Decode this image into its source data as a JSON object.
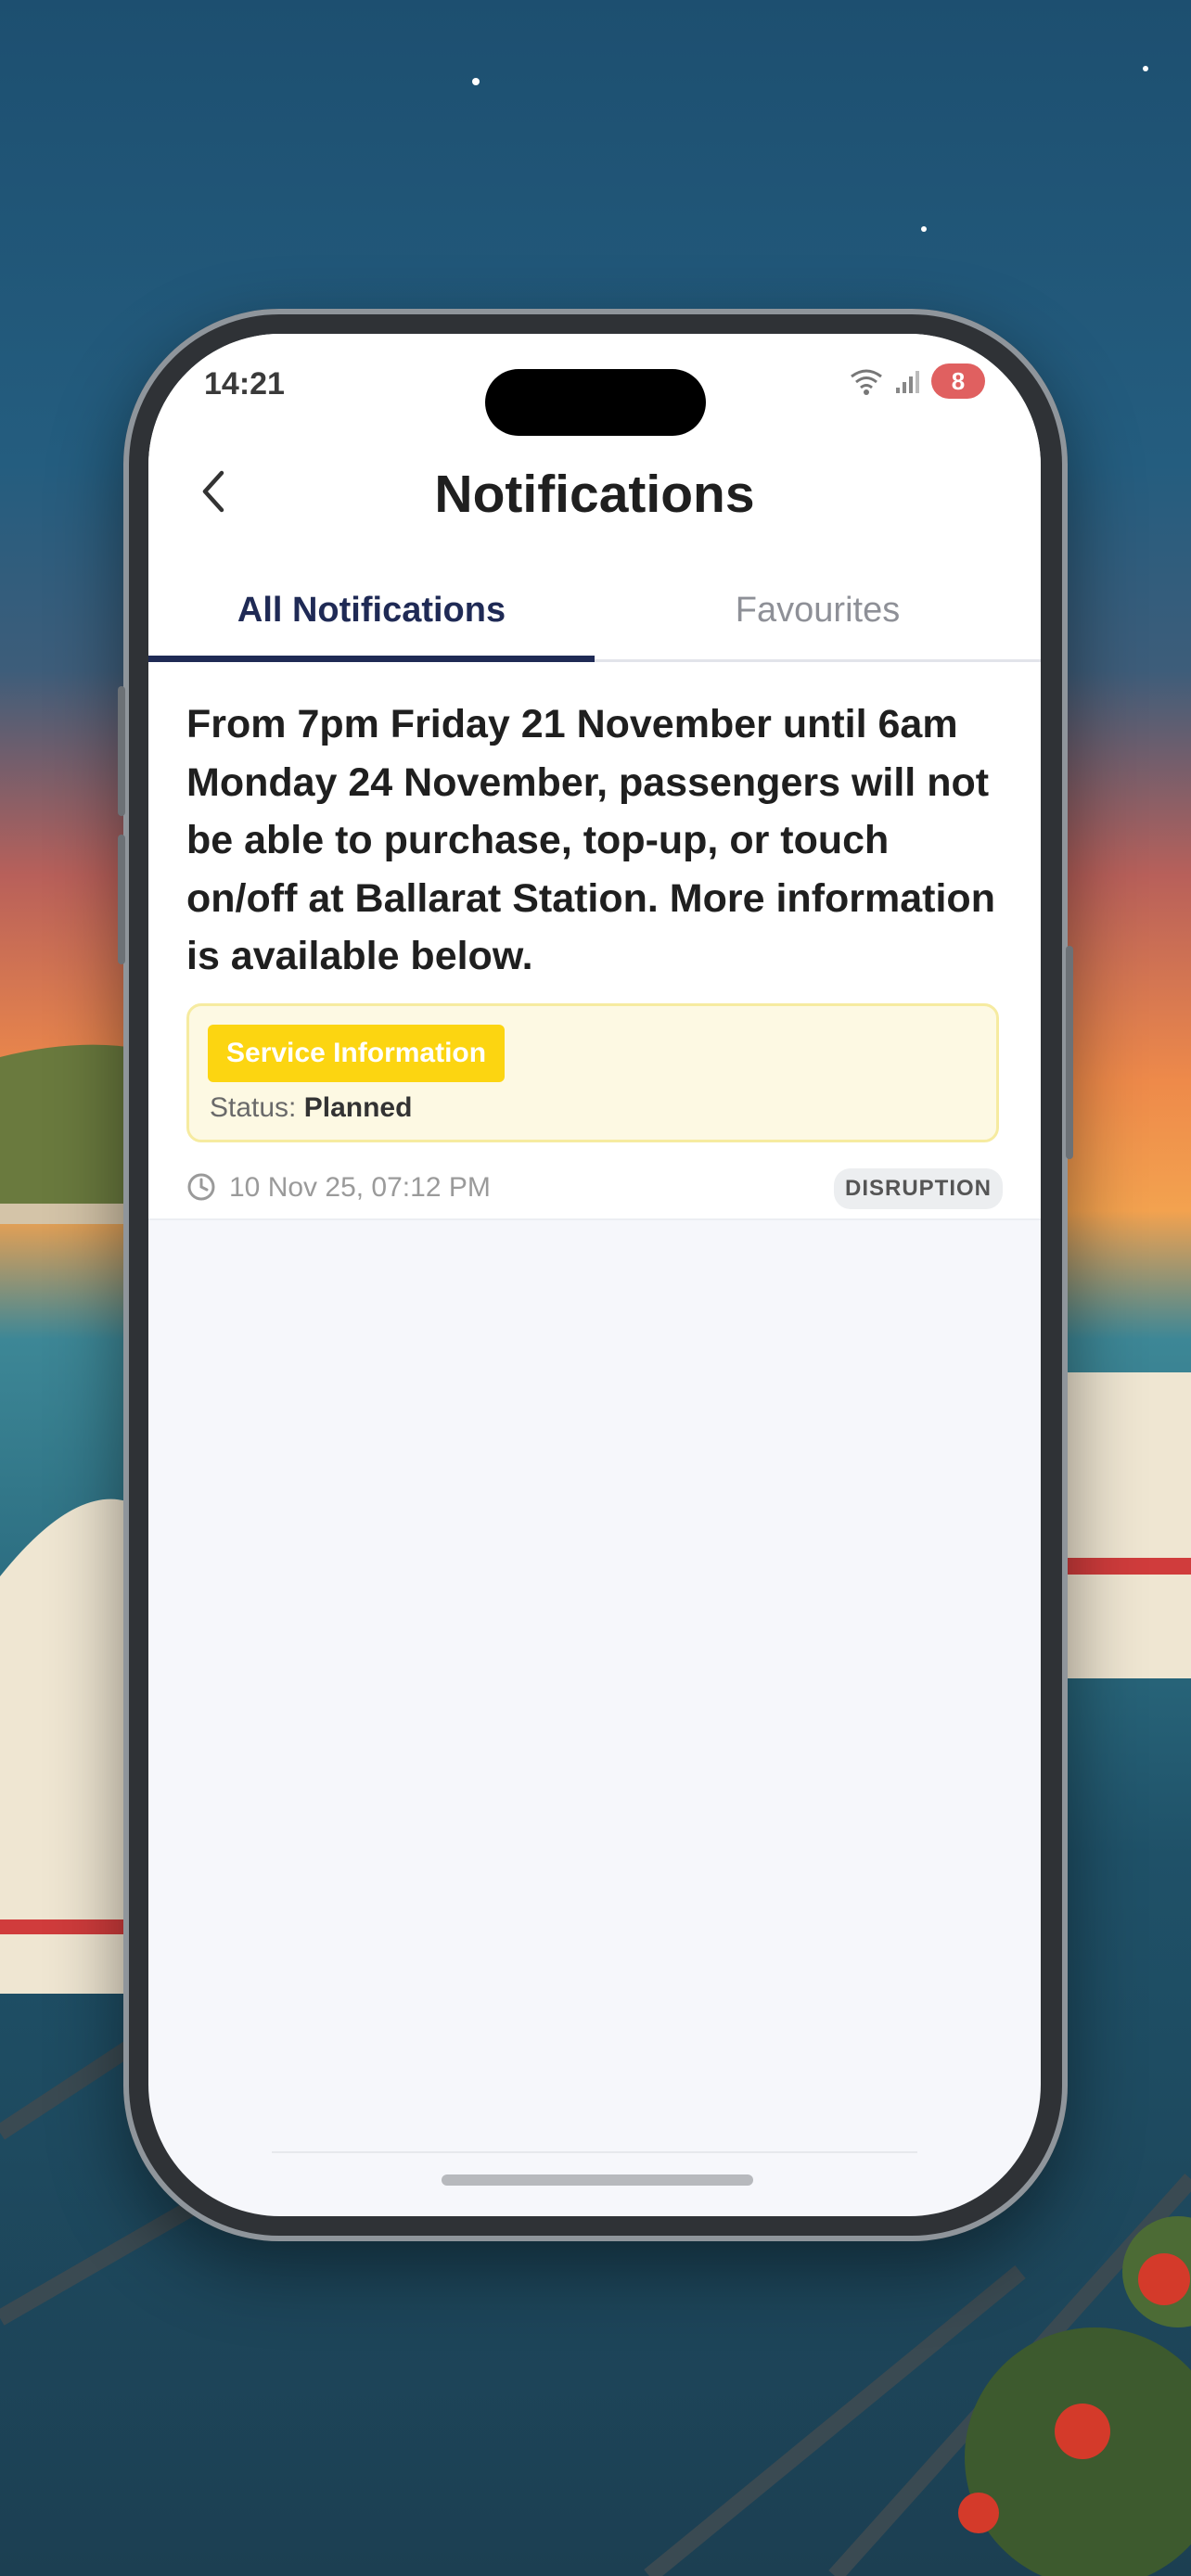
{
  "status_bar": {
    "time": "14:21",
    "battery": "8"
  },
  "nav": {
    "title": "Notifications"
  },
  "tabs": [
    {
      "label": "All Notifications",
      "active": true
    },
    {
      "label": "Favourites",
      "active": false
    }
  ],
  "notification": {
    "message": "From 7pm Friday 21 November until 6am Monday 24 November, passengers will not be able to purchase, top-up, or touch on/off at Ballarat Station. More information is available below.",
    "category": "Service Information",
    "status_label": "Status:",
    "status_value": "Planned",
    "timestamp": "10 Nov 25, 07:12 PM",
    "tag": "DISRUPTION"
  },
  "colors": {
    "accent": "#1f2a55",
    "badge": "#fcd511",
    "info_bg": "#fdf9e3",
    "battery": "#e06060"
  },
  "icons": [
    "back-chevron-icon",
    "wifi-icon",
    "signal-icon",
    "clock-icon"
  ]
}
